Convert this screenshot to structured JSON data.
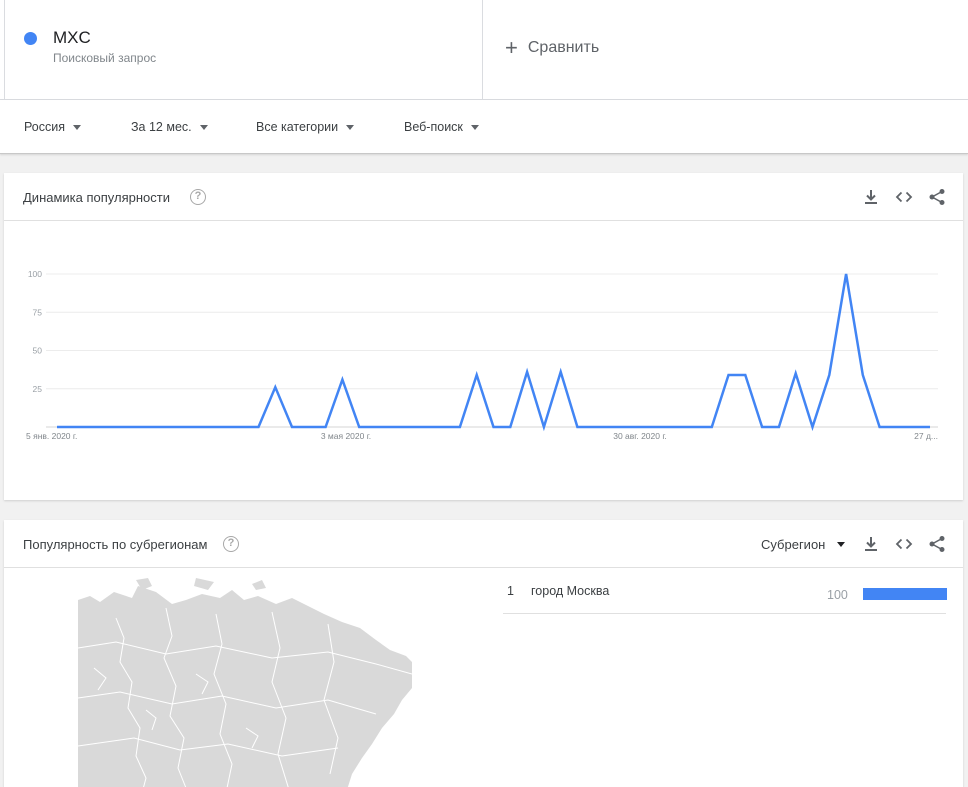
{
  "search_term": {
    "name": "MXC",
    "subtitle": "Поисковый запрос",
    "color": "#4285f4"
  },
  "compare": {
    "label": "Сравнить"
  },
  "filters": {
    "region": "Россия",
    "period": "За 12 мес.",
    "category": "Все категории",
    "search_type": "Веб-поиск"
  },
  "interest_card": {
    "title": "Динамика популярности",
    "help": "?",
    "tools": [
      "download-icon",
      "embed-icon",
      "share-icon"
    ]
  },
  "subregion_card": {
    "title": "Популярность по субрегионам",
    "help": "?",
    "selector": "Субрегион",
    "tools": [
      "download-icon",
      "embed-icon",
      "share-icon"
    ],
    "rows": [
      {
        "rank": "1",
        "name": "город Москва",
        "value": 100
      }
    ]
  },
  "chart_data": {
    "type": "line",
    "x_labels": [
      "5 янв. 2020 г.",
      "3 мая 2020 г.",
      "30 авг. 2020 г.",
      "27 д..."
    ],
    "y_ticks": [
      "25",
      "50",
      "75",
      "100"
    ],
    "ylim": [
      0,
      100
    ],
    "grid": true,
    "series": [
      {
        "color": "#4285f4",
        "values": [
          0,
          0,
          0,
          0,
          0,
          0,
          0,
          0,
          0,
          0,
          0,
          0,
          0,
          26,
          0,
          0,
          0,
          31,
          0,
          0,
          0,
          0,
          0,
          0,
          0,
          34,
          0,
          0,
          36,
          0,
          36,
          0,
          0,
          0,
          0,
          0,
          0,
          0,
          0,
          0,
          34,
          34,
          0,
          0,
          35,
          0,
          34,
          100,
          34,
          0,
          0,
          0,
          0
        ]
      }
    ]
  }
}
